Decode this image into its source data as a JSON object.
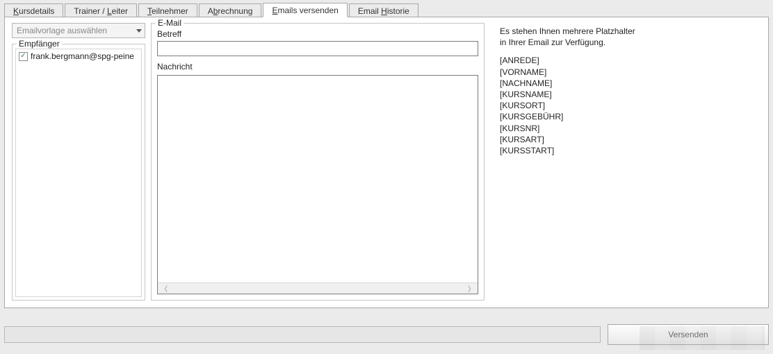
{
  "tabs": [
    {
      "pre": "",
      "u": "K",
      "post": "ursdetails"
    },
    {
      "pre": "Trainer / ",
      "u": "L",
      "post": "eiter"
    },
    {
      "pre": "",
      "u": "T",
      "post": "eilnehmer"
    },
    {
      "pre": "A",
      "u": "b",
      "post": "rechnung"
    },
    {
      "pre": "",
      "u": "E",
      "post": "mails versenden"
    },
    {
      "pre": "Email ",
      "u": "H",
      "post": "istorie"
    }
  ],
  "active_tab_index": 4,
  "dropdown_placeholder": "Emailvorlage auswählen",
  "recipients_legend": "Empfänger",
  "recipients": [
    {
      "checked": true,
      "email": "frank.bergmann@spg-peine"
    }
  ],
  "email_legend": "E-Mail",
  "subject_label": "Betreff",
  "subject_value": "",
  "message_label": "Nachricht",
  "message_value": "",
  "info_line1": "Es stehen Ihnen mehrere Platzhalter",
  "info_line2": "in Ihrer Email zur Verfügung.",
  "placeholders": [
    "[ANREDE]",
    "[VORNAME]",
    "[NACHNAME]",
    "[KURSNAME]",
    "[KURSORT]",
    "[KURSGEBÜHR]",
    "[KURSNR]",
    "[KURSART]",
    "[KURSSTART]"
  ],
  "send_button": "Versenden"
}
